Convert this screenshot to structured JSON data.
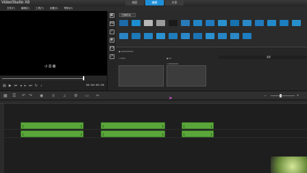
{
  "app": {
    "title": "VideoStudio X8"
  },
  "tabs": [
    {
      "label": "捕获",
      "active": false
    },
    {
      "label": "编辑",
      "active": true
    },
    {
      "label": "共享",
      "active": false
    }
  ],
  "menu": [
    "文件(F)",
    "编辑(E)",
    "工具(T)",
    "设置(S)",
    "帮助(H)"
  ],
  "preview": {
    "overlay_text": "小 首 播",
    "scrub_position": 0.78
  },
  "library": {
    "dropdown_label": "已随机轨",
    "thumbs": [
      {
        "label": "",
        "color": "#1d6aa8"
      },
      {
        "label": "",
        "color": "#1d8fd0"
      },
      {
        "label": "",
        "color": "#b8b8b8"
      },
      {
        "label": "",
        "color": "#9a9a9a"
      },
      {
        "label": "",
        "color": "#1a1a1a"
      },
      {
        "label": "",
        "color": "#2a7ab8"
      },
      {
        "label": "",
        "color": "#2384c4"
      },
      {
        "label": "",
        "color": "#1f7bbd"
      },
      {
        "label": "",
        "color": "#2a90d0"
      },
      {
        "label": "",
        "color": "#1673b0"
      },
      {
        "label": "",
        "color": "#2a88c8"
      },
      {
        "label": "",
        "color": "#1f7bbd"
      },
      {
        "label": "",
        "color": "#228ac9"
      },
      {
        "label": "",
        "color": "#1d7ec0"
      },
      {
        "label": "",
        "color": "#2790cc"
      },
      {
        "label": "",
        "color": "#2a84c4"
      },
      {
        "label": "",
        "color": "#1c78b8"
      },
      {
        "label": "",
        "color": "#2286c6"
      },
      {
        "label": "",
        "color": "#2b92d0"
      },
      {
        "label": "",
        "color": "#1e7cbc"
      },
      {
        "label": "",
        "color": "#2a88c8"
      },
      {
        "label": "",
        "color": "#1b74b4"
      },
      {
        "label": "",
        "color": "#2a90d0"
      },
      {
        "label": "",
        "color": "#2584c4"
      },
      {
        "label": "",
        "color": "#2a88c8"
      },
      {
        "label": "",
        "color": "#1d7ec0"
      }
    ],
    "options_label": "选项"
  },
  "controls": {
    "timecode": "00:00:00:00"
  },
  "timeline": {
    "clip_color": "#5aa63b"
  }
}
